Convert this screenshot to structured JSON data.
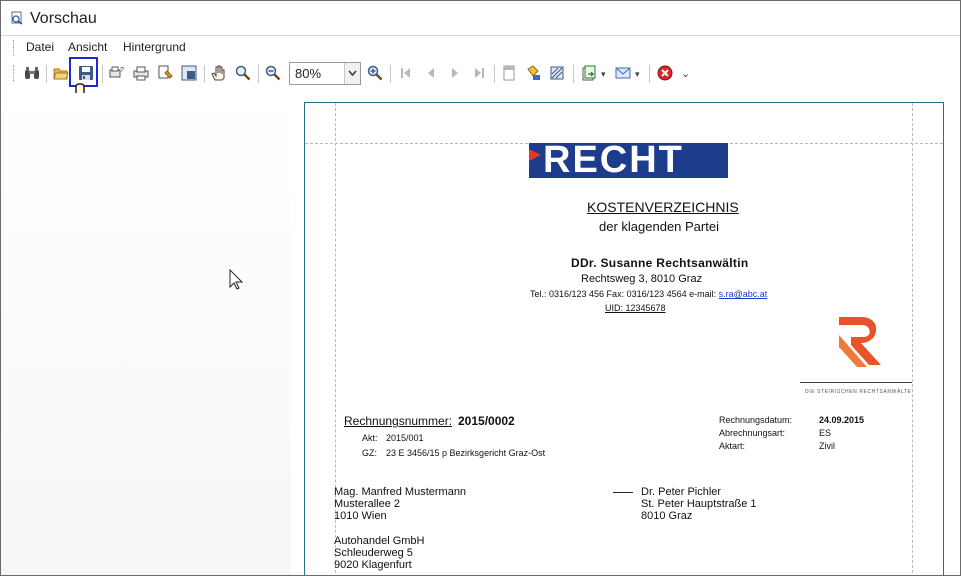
{
  "window": {
    "title": "Vorschau"
  },
  "menu": {
    "items": [
      "Datei",
      "Ansicht",
      "Hintergrund"
    ]
  },
  "toolbar": {
    "zoom_value": "80%",
    "icons": [
      "binoculars-icon",
      "open-folder-icon",
      "save-icon",
      "page-setup-icon",
      "print-icon",
      "print-options-icon",
      "export-icon",
      "hand-pan-icon",
      "magnifier-icon",
      "zoom-out-icon",
      "zoom-select",
      "zoom-in-icon",
      "first-page-icon",
      "previous-page-icon",
      "next-page-icon",
      "last-page-icon",
      "header-footer-icon",
      "background-color-icon",
      "watermark-icon",
      "export-document-icon",
      "email-icon",
      "close-preview-icon"
    ]
  },
  "document": {
    "logo_text": "RECHT",
    "heading": "KOSTENVERZEICHNIS",
    "subheading": "der klagenden Partei",
    "lawyer_name": "DDr. Susanne Rechtsanwältin",
    "address": "Rechtsweg 3, 8010 Graz",
    "contact_prefix": "Tel.: 0316/123 456 Fax: 0316/123 4564 e-mail: ",
    "email": "s.ra@abc.at",
    "uid": "UID: 12345678",
    "emblem_caption": "DIE STEIRISCHEN RECHTSANWÄLTE",
    "invoice_label": "Rechnungsnummer:",
    "invoice_number": "2015/0002",
    "akt_label": "Akt:",
    "akt_value": "2015/001",
    "gz_label": "GZ:",
    "gz_value": "23 E 3456/15 p Bezirksgericht Graz-Ost",
    "meta": [
      {
        "label": "Rechnungsdatum:",
        "value": "24.09.2015"
      },
      {
        "label": "Abrechnungsart:",
        "value": "ES"
      },
      {
        "label": "Aktart:",
        "value": "Zivil"
      }
    ],
    "client_lines": [
      "Mag. Manfred Mustermann",
      "Musterallee 2",
      "1010 Wien"
    ],
    "opponent_lines": [
      "Dr. Peter Pichler",
      "St. Peter Hauptstraße 1",
      "8010 Graz"
    ],
    "second_client_lines": [
      "Autohandel GmbH",
      "Schleuderweg 5",
      "9020 Klagenfurt"
    ]
  }
}
